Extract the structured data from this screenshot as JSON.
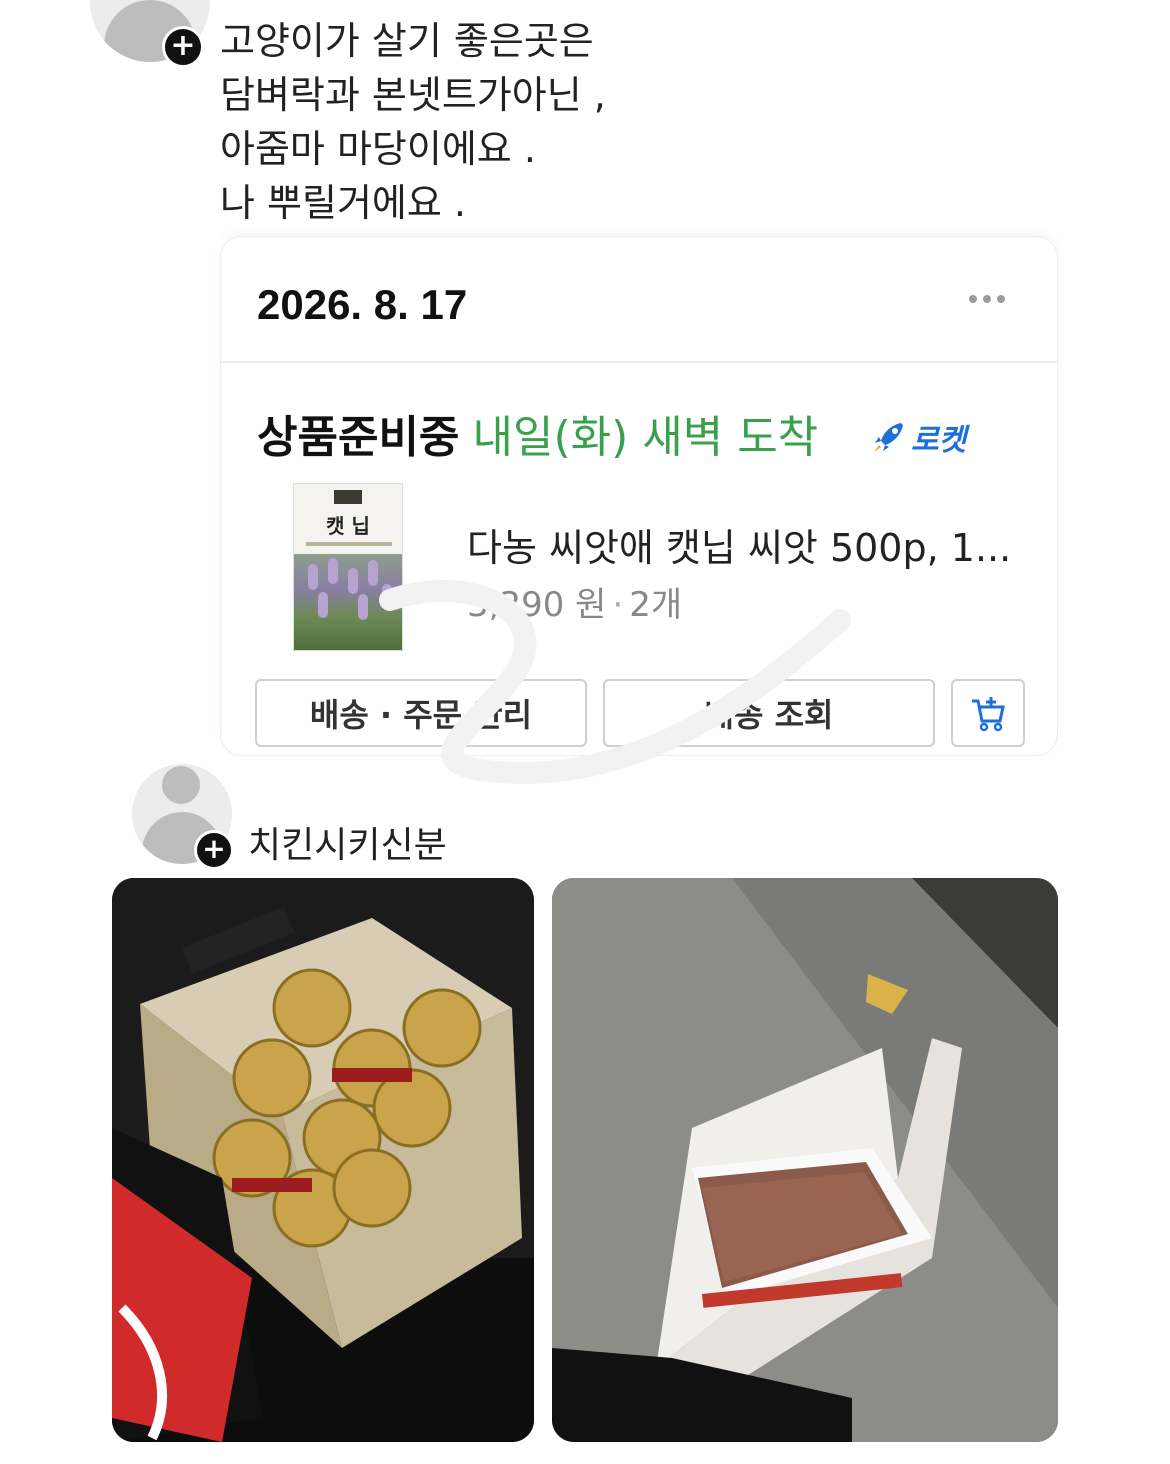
{
  "post1": {
    "lines": [
      "고양이가 살기 좋은곳은",
      "담벼락과 본넷트가아닌 ,",
      "아줌마 마당이에요 .",
      "나 뿌릴거에요 ."
    ]
  },
  "order": {
    "date": "2026. 8. 17",
    "status": "상품준비중",
    "arrival": "내일(화) 새벽 도착",
    "badge": "로켓",
    "thumb_label": "캣 닙",
    "product_name": "다농 씨앗애 캣닙 씨앗 500p, 1...",
    "price": "3,290 원",
    "quantity": "2개",
    "buttons": {
      "manage": "배송 · 주문 관리",
      "track": "배송 조회"
    },
    "colors": {
      "arrival": "#3aa04b",
      "badge": "#1e6fd9"
    }
  },
  "post2": {
    "username": "치킨시키신분"
  },
  "icons": {
    "plus": "+",
    "more": "more-dots-icon",
    "rocket": "rocket-icon",
    "cart": "add-to-cart-icon"
  }
}
